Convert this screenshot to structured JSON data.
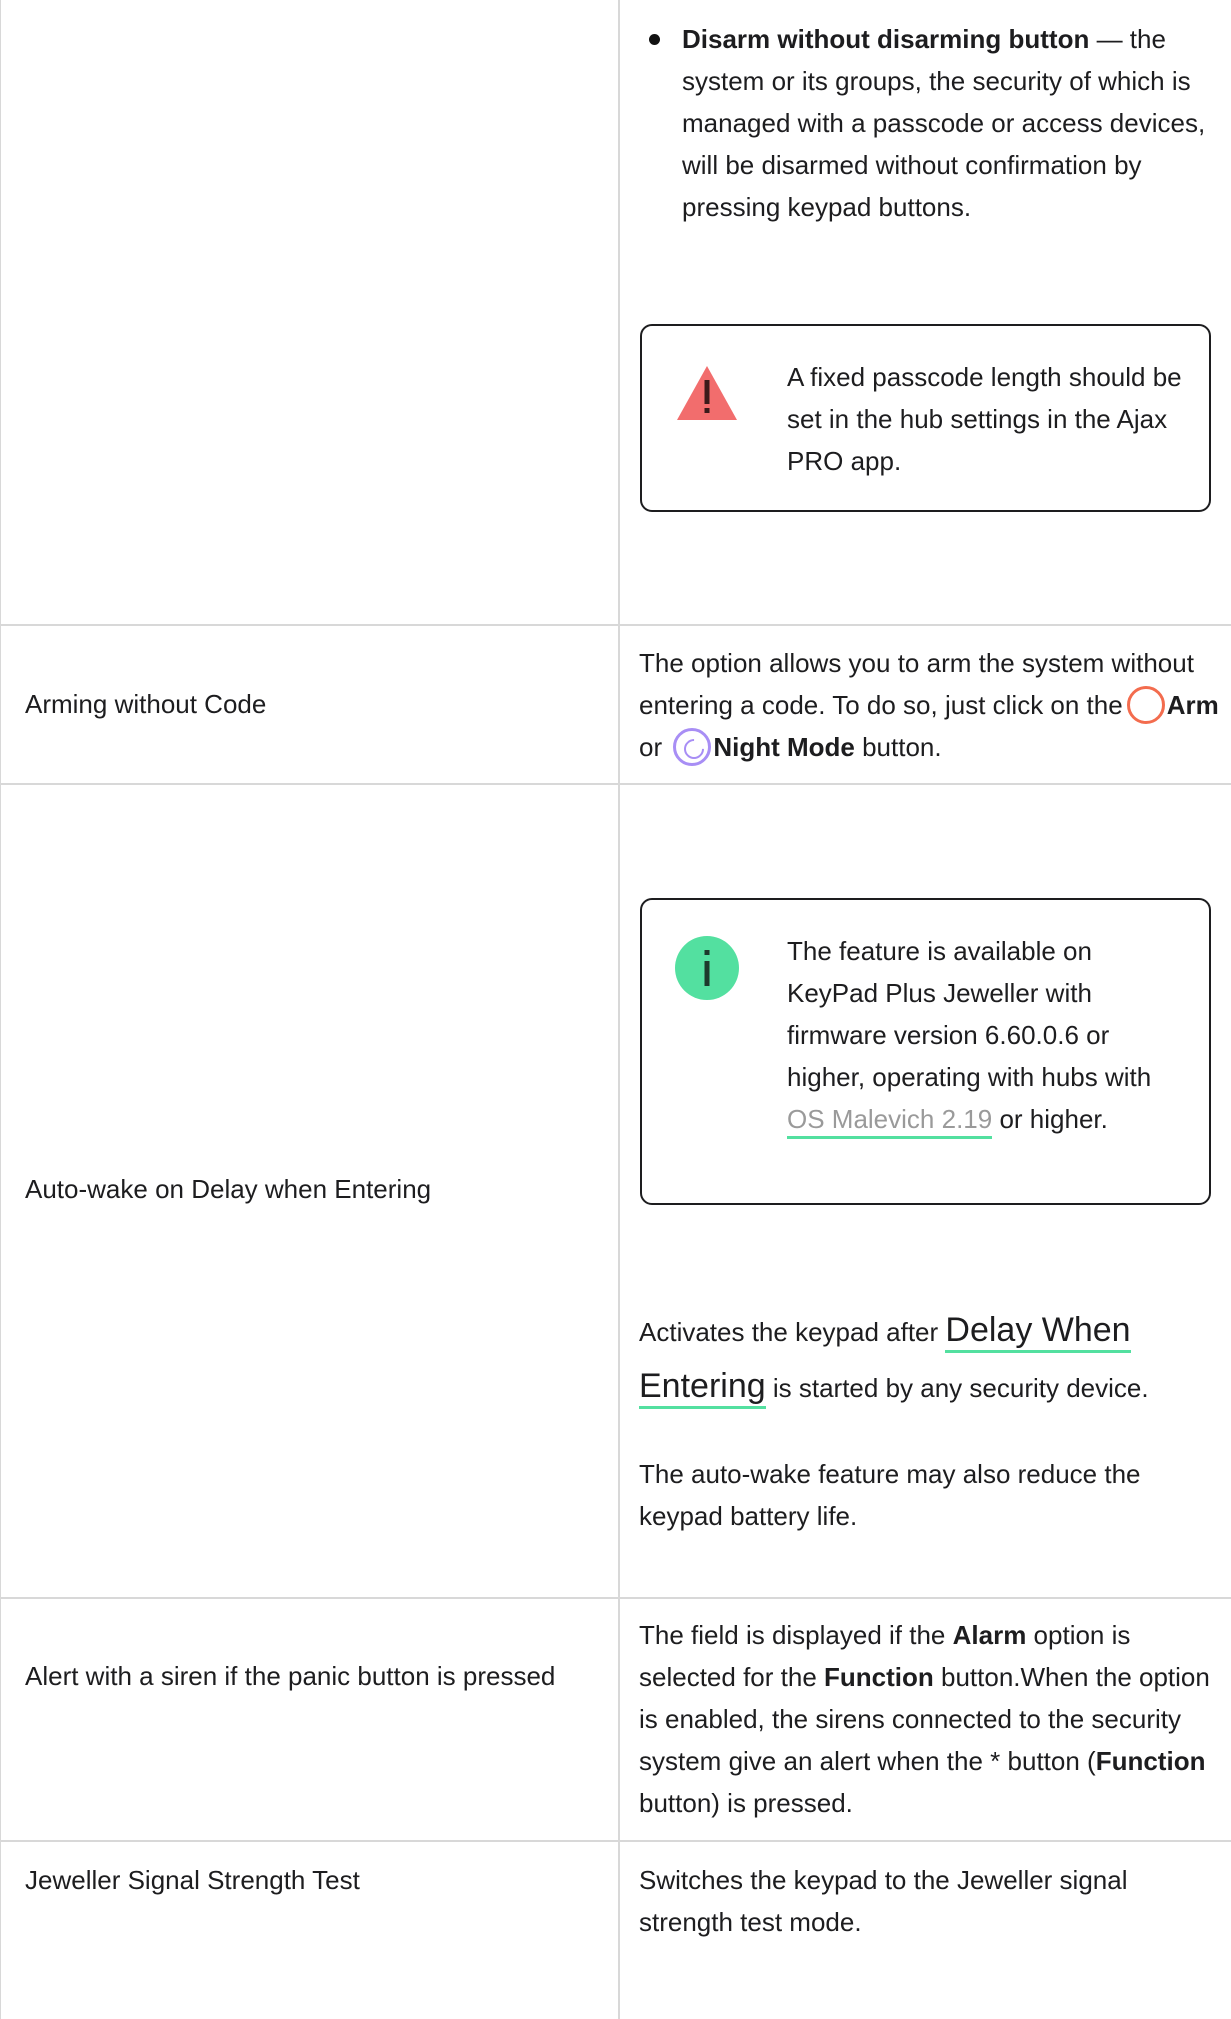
{
  "rows": [
    {
      "bullet_bold": "Disarm without disarming button",
      "bullet_rest": " — the system or its groups, the security of which is managed with a passcode or access devices, will be disarmed without confirmation by pressing keypad buttons.",
      "note_text": "A fixed passcode length should be set in the hub settings in the Ajax PRO app.",
      "note_icon": "warning-triangle-icon"
    },
    {
      "label": "Arming without Code",
      "desc_1": "The option allows you to arm the system without entering a code. To do so, just click on the",
      "arm_label": "Arm",
      "or": " or ",
      "night_label": "Night Mode",
      "desc_2": " button."
    },
    {
      "label": "Auto-wake on Delay when Entering",
      "note_icon": "info-icon",
      "note_text_1": "The feature is available on KeyPad Plus Jeweller with firmware version 6.60.0.6 or higher, operating with hubs with ",
      "note_link": "OS Malevich 2.19",
      "note_text_2": " or higher.",
      "para1_1": "Activates the keypad after ",
      "para1_link": "Delay When Entering",
      "para1_2": " is started by any security device.",
      "para2": "The auto-wake feature may also reduce the keypad battery life."
    },
    {
      "label": "Alert with a siren if the panic button is pressed",
      "d1": "The field is displayed if the ",
      "b1": "Alarm",
      "d2": " option is selected for the ",
      "b2": "Function",
      "d3": " button.When the option is enabled, the sirens connected to the security system give an alert when the * button (",
      "b3": "Function",
      "d4": " button) is pressed."
    },
    {
      "label": "Jeweller Signal Strength Test",
      "desc": "Switches the keypad to the Jeweller signal strength test mode."
    }
  ],
  "colors": {
    "warning": "#f26d6d",
    "info": "#53e0a0",
    "arm": "#f36c4e",
    "night": "#a88ef5",
    "link_underline": "#53e0a0"
  }
}
